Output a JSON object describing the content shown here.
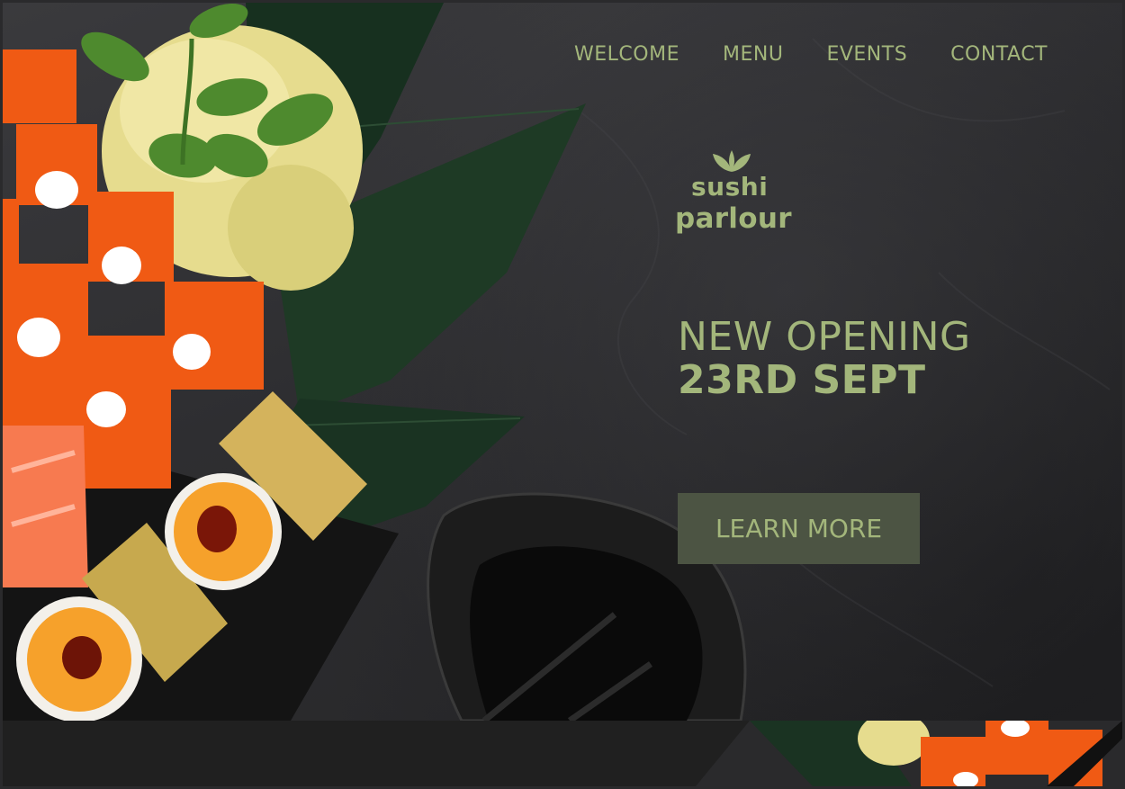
{
  "nav": {
    "items": [
      {
        "label": "WELCOME"
      },
      {
        "label": "MENU"
      },
      {
        "label": "EVENTS"
      },
      {
        "label": "CONTACT"
      }
    ]
  },
  "logo": {
    "line1": "sushi",
    "line2": "parlour"
  },
  "headline": {
    "line1": "NEW OPENING",
    "line2": "23RD SEPT"
  },
  "cta": {
    "label": "LEARN MORE"
  },
  "colors": {
    "accent": "#a3b67b",
    "button_bg": "#4c5443",
    "background": "#2e2e31",
    "footer": "#202020"
  },
  "icons": {
    "logo_leaf": "leaf-icon"
  }
}
